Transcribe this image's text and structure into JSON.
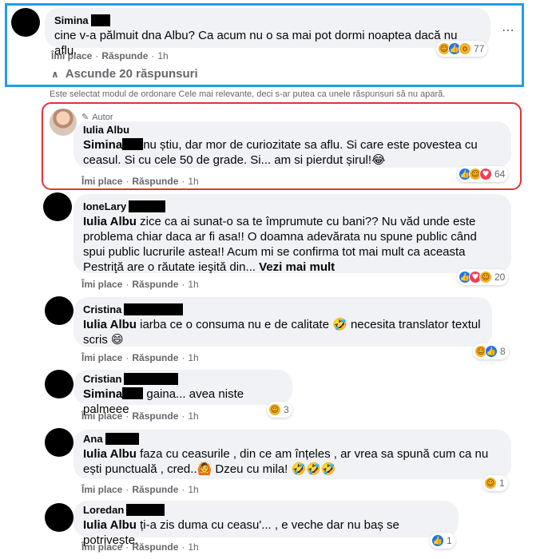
{
  "ui": {
    "like": "Îmi place",
    "reply": "Răspunde",
    "sep": "·",
    "time": "1h",
    "collapse_replies": "Ascunde 20 răspunsuri",
    "sort_note": "Este selectat modul de ordonare Cele mai relevante, deci s-ar putea ca unele răspunsuri să nu apară.",
    "author_badge": "Autor",
    "more_icon": "⋯"
  },
  "colors": {
    "highlight_blue": "#1ca1e2",
    "highlight_red": "#e03434",
    "bubble": "#f0f2f5",
    "meta": "#65676b"
  },
  "comments": [
    {
      "author": "Simina",
      "text": "cine v-a pălmuit dna Albu? Ca acum nu o sa mai pot dormi noaptea dacă nu aflu.",
      "reactions": [
        "haha",
        "like",
        "wow"
      ],
      "reaction_count": "77"
    },
    {
      "author": "Iulia Albu",
      "mention": "Simina",
      "text": "nu știu, dar mor de curiozitate sa aflu. Si care este povestea cu ceasul. Si cu cele 50 de grade. Si... am si pierdut șirul!😂",
      "reactions": [
        "like",
        "haha",
        "love"
      ],
      "reaction_count": "64"
    },
    {
      "author": "IoneLary",
      "mention": "Iulia Albu",
      "text": "zice ca ai sunat-o sa te împrumute cu bani?? Nu văd unde este problema chiar daca ar fi asa!! O doamna adevărata nu spune public când spui public lucrurile astea!! Acum mi se confirma tot mai mult ca aceasta Pestriţă are o răutate ieşită din...",
      "more": "Vezi mai mult",
      "reactions": [
        "like",
        "love",
        "haha"
      ],
      "reaction_count": "20"
    },
    {
      "author": "Cristina",
      "mention": "Iulia Albu",
      "text": "iarba ce o consuma nu e de calitate 🤣 necesita translator textul scris 😄",
      "reactions": [
        "haha",
        "like"
      ],
      "reaction_count": "8"
    },
    {
      "author": "Cristian",
      "mention": "Simina",
      "text": "gaina... avea niste palmeee",
      "reactions": [
        "haha"
      ],
      "reaction_count": "3"
    },
    {
      "author": "Ana",
      "mention": "Iulia Albu",
      "text": "faza cu ceasurile , din ce am înțeles , ar vrea sa spună cum ca nu ești punctuală , cred..🙆 Dzeu cu mila! 🤣🤣🤣",
      "reactions": [
        "haha"
      ],
      "reaction_count": "1"
    },
    {
      "author": "Loredan",
      "mention": "Iulia Albu",
      "text": "ți-a zis duma cu ceasu'... , e veche dar nu baș se potrivește.",
      "reactions": [
        "like"
      ],
      "reaction_count": "1"
    }
  ]
}
